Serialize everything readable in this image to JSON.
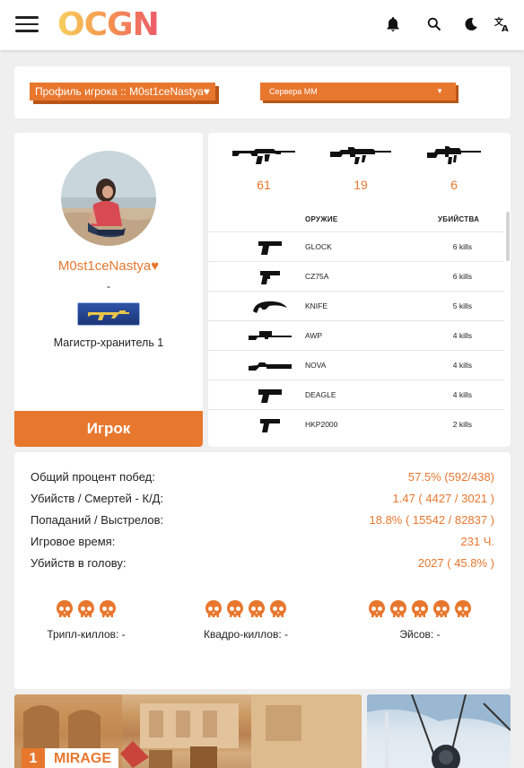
{
  "header": {
    "logo": "OCGN",
    "icons": [
      "menu-icon",
      "bell-icon",
      "search-icon",
      "moon-icon",
      "translate-icon"
    ]
  },
  "topbar": {
    "profile_label": "Профиль игрока :: M0st1ceNastya♥",
    "servers_label": "Сервера ММ",
    "servers_caret": "▼"
  },
  "profile": {
    "name": "M0st1ceNastya♥",
    "dash": "-",
    "rank": "Магистр-хранитель 1",
    "player_button": "Игрок"
  },
  "weapons": {
    "top": [
      {
        "icon": "ak47-icon",
        "count": "61"
      },
      {
        "icon": "m4a4-icon",
        "count": "19"
      },
      {
        "icon": "m4a1-icon",
        "count": "6"
      }
    ],
    "col_weapon": "ОРУЖИЕ",
    "col_kills": "УБИЙСТВА",
    "rows": [
      {
        "icon": "glock-icon",
        "name": "GLOCK",
        "kills": "6 kills"
      },
      {
        "icon": "cz75a-icon",
        "name": "CZ75A",
        "kills": "6 kills"
      },
      {
        "icon": "knife-icon",
        "name": "KNIFE",
        "kills": "5 kills"
      },
      {
        "icon": "awp-icon",
        "name": "AWP",
        "kills": "4 kills"
      },
      {
        "icon": "nova-icon",
        "name": "NOVA",
        "kills": "4 kills"
      },
      {
        "icon": "deagle-icon",
        "name": "DEAGLE",
        "kills": "4 kills"
      },
      {
        "icon": "hkp2000-icon",
        "name": "HKP2000",
        "kills": "2 kills"
      }
    ]
  },
  "stats": {
    "rows": [
      {
        "label": "Общий процент побед:",
        "value": "57.5% (592/438)"
      },
      {
        "label": "Убийств / Смертей - К/Д:",
        "value": "1.47 ( 4427 / 3021 )"
      },
      {
        "label": "Попаданий / Выстрелов:",
        "value": "18.8% ( 15542 / 82837 )"
      },
      {
        "label": "Игровое время:",
        "value": "231 Ч."
      },
      {
        "label": "Убийств в голову:",
        "value": "2027 ( 45.8% )"
      }
    ],
    "multikills": [
      {
        "label": "Трипл-киллов: -",
        "skulls": 3
      },
      {
        "label": "Квадро-киллов: -",
        "skulls": 4
      },
      {
        "label": "Эйсов: -",
        "skulls": 5
      }
    ]
  },
  "maps": [
    {
      "num": "1",
      "name": "MIRAGE"
    }
  ],
  "colors": {
    "accent": "#e8772e",
    "accent_shadow": "#b95517",
    "background": "#efefef"
  }
}
